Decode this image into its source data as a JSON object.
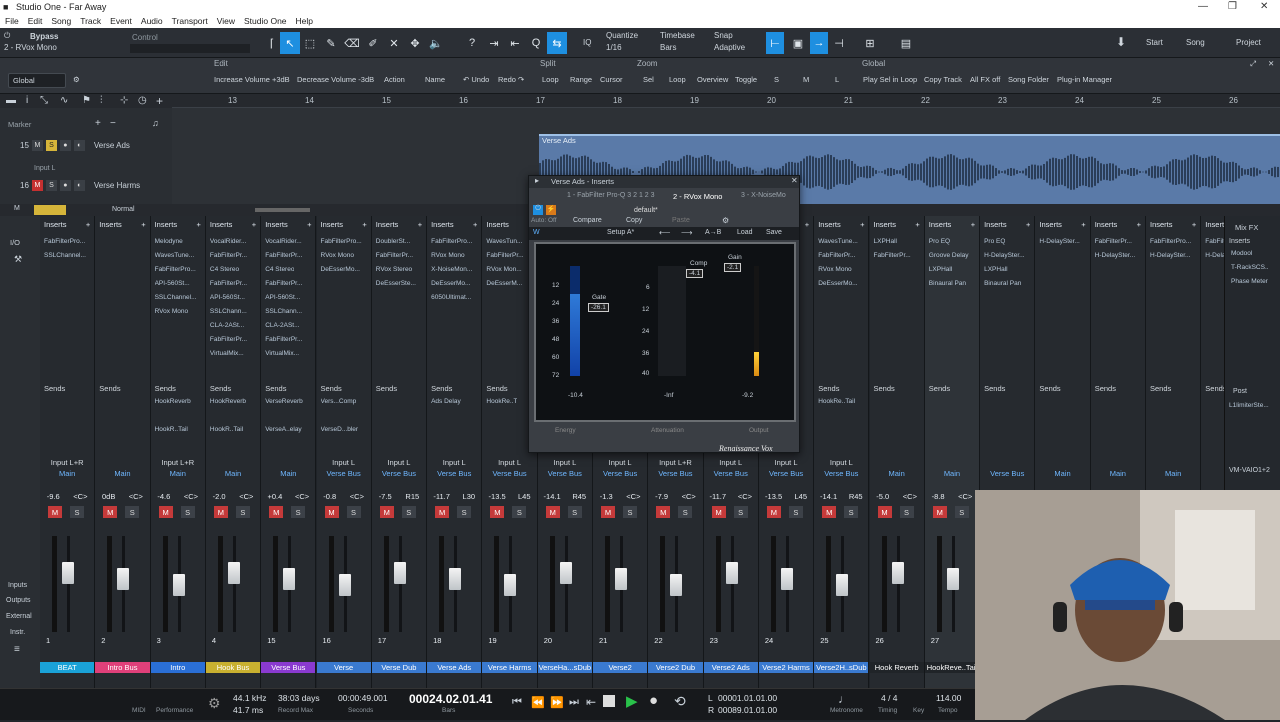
{
  "window": {
    "title": "Studio One - Far Away",
    "controls": [
      "—",
      "❐",
      "✕"
    ]
  },
  "menu": [
    "File",
    "Edit",
    "Song",
    "Track",
    "Event",
    "Audio",
    "Transport",
    "View",
    "Studio One",
    "Help"
  ],
  "toolbar": {
    "preset_title": "Bypass",
    "preset_sub": "2 - RVox Mono",
    "control_label": "Control",
    "quantize_label": "Quantize",
    "quantize_value": "1/16",
    "timebase_label": "Timebase",
    "timebase_value": "Bars",
    "snap_label": "Snap",
    "snap_value": "Adaptive",
    "iq": "IQ",
    "start": "Start",
    "song": "Song",
    "project": "Project"
  },
  "macro": {
    "groups": [
      "Edit",
      "Split",
      "Zoom",
      "Global"
    ],
    "global_dd": "Global",
    "edit_items": [
      "Increase Volume +3dB",
      "Decrease Volume -3dB",
      "Action",
      "Name",
      "↶ Undo",
      "Redo ↷"
    ],
    "split_items": [
      "Loop",
      "Range",
      "Cursor"
    ],
    "zoom_items": [
      "Sel",
      "Loop",
      "Overview",
      "Toggle",
      "S",
      "M",
      "L"
    ],
    "global_items": [
      "Play Sel in Loop",
      "Copy Track",
      "All FX off",
      "Song Folder",
      "Plug-in Manager"
    ]
  },
  "ruler": [
    "13",
    "14",
    "15",
    "16",
    "17",
    "18",
    "19",
    "20",
    "21",
    "22",
    "23",
    "24",
    "25",
    "26"
  ],
  "tracks": [
    {
      "num": "15",
      "name": "Verse Ads",
      "input": "Input L"
    },
    {
      "num": "16",
      "name": "Verse Harms"
    }
  ],
  "arrange": {
    "clip_name": "Verse Ads",
    "marker": "Marker",
    "mode": "Normal"
  },
  "plugin": {
    "title": "Verse Ads - Inserts",
    "slots": [
      "1 - FabFilter Pro-Q 3 2 1 2 3",
      "2 - RVox Mono",
      "3 - X-NoiseMo"
    ],
    "preset": "default*",
    "compare": "Compare",
    "copy": "Copy",
    "paste": "Paste",
    "setup": "Setup A*",
    "ab": "A→B",
    "load": "Load",
    "save": "Save",
    "auto": "Auto: Off",
    "gate_label": "Gate",
    "gate_value": "-26.1",
    "comp_label": "Comp",
    "comp_value": "-4.1",
    "gain_label": "Gain",
    "gain_value": "-2.1",
    "left_scale": [
      "12",
      "24",
      "36",
      "48",
      "60",
      "72"
    ],
    "mid_scale": [
      "6",
      "12",
      "24",
      "36",
      "40"
    ],
    "bottom_left": "-10.4",
    "bottom_mid": "-Inf",
    "bottom_right": "-9.2",
    "energy": "Energy",
    "attenuation": "Attenuation",
    "output": "Output",
    "brand": "Renaissance Vox"
  },
  "mixer": {
    "inserts": "Inserts",
    "sends": "Sends",
    "post": "Post",
    "mixfx": "Mix FX",
    "io": "I/O",
    "inputs": "Inputs",
    "outputs": "Outputs",
    "external": "External",
    "instr": "Instr.",
    "strips": [
      {
        "num": "1",
        "name": "BEAT",
        "io1": "Input L+R",
        "io2": "Main",
        "vol": "-9.6",
        "pan": "<C>",
        "color": "#1aa2d8",
        "plugs": [
          "FabFilterPro...",
          "SSLChannel..."
        ],
        "sends": []
      },
      {
        "num": "2",
        "name": "Intro Bus",
        "io1": "",
        "io2": "Main",
        "vol": "0dB",
        "pan": "<C>",
        "color": "#e0407a",
        "plugs": [],
        "sends": []
      },
      {
        "num": "3",
        "name": "Intro",
        "io1": "Input L+R",
        "io2": "Main",
        "vol": "-4.6",
        "pan": "<C>",
        "color": "#2a6fd6",
        "plugs": [
          "Melodyne",
          "WavesTune...",
          "FabFilterPro...",
          "API-560St...",
          "SSLChannel...",
          "RVox Mono"
        ],
        "sends": [
          "HookReverb",
          "HookR..Tail"
        ]
      },
      {
        "num": "4",
        "name": "Hook Bus",
        "io1": "",
        "io2": "Main",
        "vol": "-2.0",
        "pan": "<C>",
        "color": "#c8b030",
        "plugs": [
          "VocalRider...",
          "FabFilterPr...",
          "C4 Stereo",
          "FabFilterPr...",
          "API-560St...",
          "SSLChann...",
          "CLA-2ASt...",
          "FabFilterPr...",
          "VirtualMix..."
        ],
        "sends": [
          "HookReverb",
          "HookR..Tail"
        ]
      },
      {
        "num": "15",
        "name": "Verse Bus",
        "io1": "",
        "io2": "Main",
        "vol": "+0.4",
        "pan": "<C>",
        "color": "#8a3ad0",
        "plugs": [
          "VocalRider...",
          "FabFilterPr...",
          "C4 Stereo",
          "FabFilterPr...",
          "API-560St...",
          "SSLChann...",
          "CLA-2ASt...",
          "FabFilterPr...",
          "VirtualMix..."
        ],
        "sends": [
          "VerseReverb",
          "VerseA..elay"
        ]
      },
      {
        "num": "16",
        "name": "Verse",
        "io1": "Input L",
        "io2": "Verse Bus",
        "vol": "-0.8",
        "pan": "<C>",
        "color": "#3a7ad0",
        "plugs": [
          "FabFilterPro...",
          "RVox Mono",
          "DeEsserMo..."
        ],
        "sends": [
          "Vers...Comp",
          "VerseD...bler"
        ]
      },
      {
        "num": "17",
        "name": "Verse Dub",
        "io1": "Input L",
        "io2": "Verse Bus",
        "vol": "-7.5",
        "pan": "R15",
        "color": "#3a7ad0",
        "plugs": [
          "DoublerSt...",
          "FabFilterPr...",
          "RVox Stereo",
          "DeEsserSte..."
        ],
        "sends": []
      },
      {
        "num": "18",
        "name": "Verse Ads",
        "io1": "Input L",
        "io2": "Verse Bus",
        "vol": "-11.7",
        "pan": "L30",
        "color": "#3a7ad0",
        "plugs": [
          "FabFilterPro...",
          "RVox Mono",
          "X-NoiseMon...",
          "DeEsserMo...",
          "6050Ultimat..."
        ],
        "sends": [
          "Ads Delay"
        ]
      },
      {
        "num": "19",
        "name": "Verse Harms",
        "io1": "Input L",
        "io2": "Verse Bus",
        "vol": "-13.5",
        "pan": "L45",
        "color": "#3a7ad0",
        "plugs": [
          "WavesTun...",
          "FabFilterPr...",
          "RVox Mon...",
          "DeEsserM..."
        ],
        "sends": [
          "HookRe..T"
        ]
      },
      {
        "num": "20",
        "name": "VerseHa...sDub",
        "io1": "Input L",
        "io2": "Verse Bus",
        "vol": "-14.1",
        "pan": "R45",
        "color": "#3a7ad0",
        "plugs": [],
        "sends": []
      },
      {
        "num": "21",
        "name": "Verse2",
        "io1": "Input L",
        "io2": "Verse Bus",
        "vol": "-1.3",
        "pan": "<C>",
        "color": "#3a7ad0",
        "plugs": [],
        "sends": []
      },
      {
        "num": "22",
        "name": "Verse2 Dub",
        "io1": "Input L+R",
        "io2": "Verse Bus",
        "vol": "-7.9",
        "pan": "<C>",
        "color": "#3a7ad0",
        "plugs": [],
        "sends": []
      },
      {
        "num": "23",
        "name": "Verse2 Ads",
        "io1": "Input L",
        "io2": "Verse Bus",
        "vol": "-11.7",
        "pan": "<C>",
        "color": "#3a7ad0",
        "plugs": [],
        "sends": []
      },
      {
        "num": "24",
        "name": "Verse2 Harms",
        "io1": "Input L",
        "io2": "Verse Bus",
        "vol": "-13.5",
        "pan": "L45",
        "color": "#3a7ad0",
        "plugs": [],
        "sends": []
      },
      {
        "num": "25",
        "name": "Verse2H..sDub",
        "io1": "Input L",
        "io2": "Verse Bus",
        "vol": "-14.1",
        "pan": "R45",
        "color": "#3a7ad0",
        "plugs": [
          "WavesTune...",
          "FabFilterPr...",
          "RVox Mono",
          "DeEsserMo..."
        ],
        "sends": [
          "HookRe..Tail"
        ]
      },
      {
        "num": "26",
        "name": "Hook Reverb",
        "io1": "",
        "io2": "Main",
        "vol": "-5.0",
        "pan": "<C>",
        "color": "#202428",
        "plugs": [
          "LXPHall",
          "FabFilterPr..."
        ],
        "sends": []
      },
      {
        "num": "27",
        "name": "HookReve..Tail",
        "io1": "",
        "io2": "Main",
        "vol": "-8.8",
        "pan": "<C>",
        "color": "#202428",
        "plugs": [
          "Pro EQ",
          "Groove Delay",
          "LXPHall",
          "Binaural Pan"
        ],
        "sends": []
      },
      {
        "num": "",
        "name": "",
        "io1": "",
        "io2": "Verse Bus",
        "vol": "",
        "pan": "",
        "color": "#202428",
        "plugs": [
          "Pro EQ",
          "H-DelaySter...",
          "LXPHall",
          "Binaural Pan"
        ],
        "sends": []
      },
      {
        "num": "",
        "name": "",
        "io1": "",
        "io2": "Main",
        "vol": "",
        "pan": "",
        "color": "#202428",
        "plugs": [
          "H-DelaySter..."
        ],
        "sends": []
      },
      {
        "num": "",
        "name": "",
        "io1": "",
        "io2": "Main",
        "vol": "",
        "pan": "",
        "color": "#202428",
        "plugs": [
          "FabFilterPr...",
          "H-DelaySter..."
        ],
        "sends": []
      },
      {
        "num": "",
        "name": "",
        "io1": "",
        "io2": "Main",
        "vol": "",
        "pan": "",
        "color": "#202428",
        "plugs": [
          "FabFilterPro...",
          "H-DelaySter..."
        ],
        "sends": []
      },
      {
        "num": "",
        "name": "",
        "io1": "",
        "io2": "",
        "vol": "",
        "pan": "",
        "color": "#202428",
        "plugs": [
          "FabFilterPr...",
          "H-DelaySte..."
        ],
        "sends": []
      }
    ],
    "master": {
      "label": "Mix FX",
      "plugs": [
        "Modool",
        "T-RackSCS..",
        "Phase Meter"
      ],
      "post": "L1limiterSte...",
      "out": "VM-VAIO1+2"
    }
  },
  "transport": {
    "midi": "MIDI",
    "performance": "Performance",
    "rate": "44.1 kHz",
    "latency": "41.7 ms",
    "days": "38:03 days",
    "record_max": "Record Max",
    "time": "00:00:49.001",
    "seconds": "Seconds",
    "bars_pos": "00024.02.01.41",
    "bars": "Bars",
    "loop_l": "00001.01.01.00",
    "loop_r": "00089.01.01.00",
    "metronome": "Metronome",
    "timing": "Timing",
    "sig": "4 / 4",
    "key": "Key",
    "tempo_label": "Tempo",
    "tempo": "114.00"
  }
}
